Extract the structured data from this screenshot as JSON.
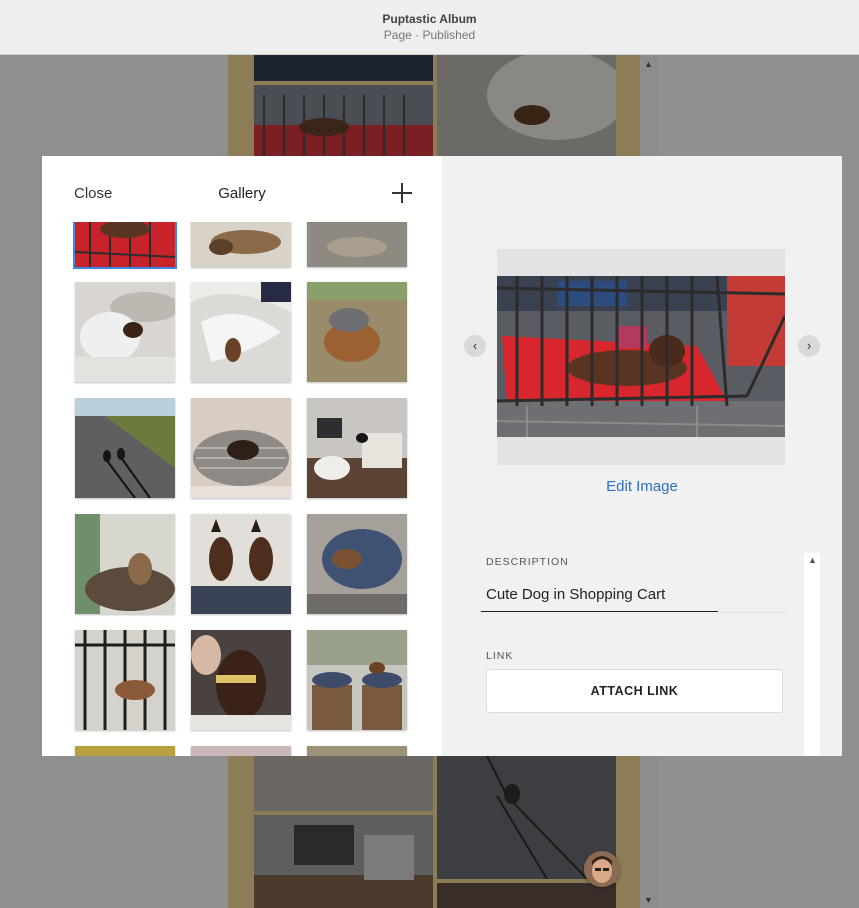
{
  "header": {
    "title": "Puptastic Album",
    "subtitle": "Page · Published"
  },
  "modal": {
    "left": {
      "close_label": "Close",
      "title": "Gallery",
      "add_icon": "plus-icon"
    },
    "right": {
      "prev_icon": "chevron-left-icon",
      "next_icon": "chevron-right-icon",
      "edit_image_label": "Edit Image",
      "description_label": "DESCRIPTION",
      "description_value": "Cute Dog in Shopping Cart",
      "link_label": "LINK",
      "attach_link_label": "ATTACH LINK"
    }
  },
  "colors": {
    "accent": "#2f6fc4",
    "selection": "#3e86e0",
    "panel": "#f1f1f1"
  }
}
